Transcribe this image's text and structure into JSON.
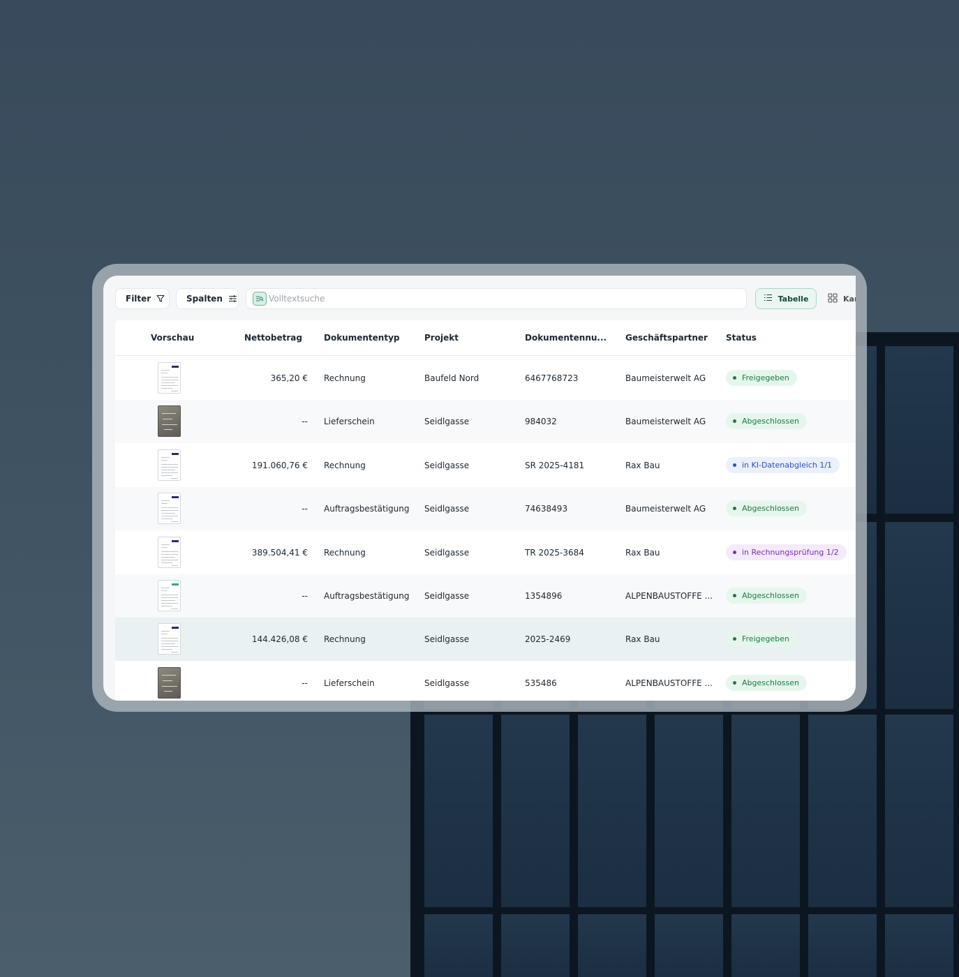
{
  "toolbar": {
    "filter_label": "Filter",
    "columns_label": "Spalten",
    "search_placeholder": "Volltextsuche",
    "view_table_label": "Tabelle",
    "view_cards_label": "Kar"
  },
  "table": {
    "headers": {
      "preview": "Vorschau",
      "net_amount": "Nettobetrag",
      "doc_type": "Dokumententyp",
      "project": "Projekt",
      "doc_number": "Dokumentennu...",
      "partner": "Geschäftspartner",
      "status": "Status"
    },
    "rows": [
      {
        "thumb": "document",
        "amount": "365,20 €",
        "type": "Rechnung",
        "project": "Baufeld Nord",
        "number": "6467768723",
        "partner": "Baumeisterwelt AG",
        "status": "Freigegeben",
        "status_color": "green"
      },
      {
        "thumb": "photo",
        "amount": "--",
        "type": "Lieferschein",
        "project": "Seidlgasse",
        "number": "984032",
        "partner": "Baumeisterwelt AG",
        "status": "Abgeschlossen",
        "status_color": "green"
      },
      {
        "thumb": "document",
        "amount": "191.060,76 €",
        "type": "Rechnung",
        "project": "Seidlgasse",
        "number": "SR 2025-4181",
        "partner": "Rax Bau",
        "status": "in KI-Datenabgleich 1/1",
        "status_color": "blue"
      },
      {
        "thumb": "document",
        "amount": "--",
        "type": "Auftragsbestätigung",
        "project": "Seidlgasse",
        "number": "74638493",
        "partner": "Baumeisterwelt AG",
        "status": "Abgeschlossen",
        "status_color": "green"
      },
      {
        "thumb": "document",
        "amount": "389.504,41 €",
        "type": "Rechnung",
        "project": "Seidlgasse",
        "number": "TR 2025-3684",
        "partner": "Rax Bau",
        "status": "in Rechnungsprüfung 1/2",
        "status_color": "purple"
      },
      {
        "thumb": "document",
        "amount": "--",
        "type": "Auftragsbestätigung",
        "project": "Seidlgasse",
        "number": "1354896",
        "partner": "ALPENBAUSTOFFE ...",
        "status": "Abgeschlossen",
        "status_color": "green"
      },
      {
        "thumb": "document",
        "amount": "144.426,08 €",
        "type": "Rechnung",
        "project": "Seidlgasse",
        "number": "2025-2469",
        "partner": "Rax Bau",
        "status": "Freigegeben",
        "status_color": "green"
      },
      {
        "thumb": "photo",
        "amount": "--",
        "type": "Lieferschein",
        "project": "Seidlgasse",
        "number": "535486",
        "partner": "ALPENBAUSTOFFE ...",
        "status": "Abgeschlossen",
        "status_color": "green"
      }
    ]
  },
  "colors": {
    "accent": "#144936",
    "status_green": "#1c7a45",
    "status_blue": "#2b4fb8",
    "status_purple": "#7a2fb0"
  }
}
